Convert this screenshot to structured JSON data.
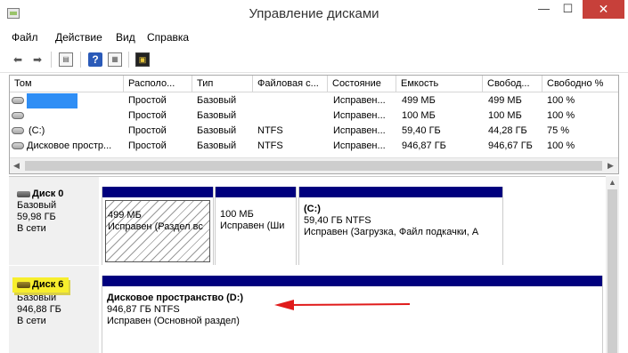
{
  "window": {
    "title": "Управление дисками",
    "minimize_glyph": "—",
    "maximize_glyph": "☐",
    "close_glyph": "✕",
    "app_icon": "disk-management-icon"
  },
  "menu": [
    "Файл",
    "Действие",
    "Вид",
    "Справка"
  ],
  "toolbar": {
    "icons": [
      "back-arrow-icon",
      "forward-arrow-icon",
      "console-tree-icon",
      "help-icon",
      "properties-icon",
      "snap-in-icon"
    ],
    "back_glyph": "⬅",
    "forward_glyph": "➡",
    "help_glyph": "?"
  },
  "volumes": {
    "columns": [
      "Том",
      "Располо...",
      "Тип",
      "Файловая с...",
      "Состояние",
      "Емкость",
      "Свобод...",
      "Свободно %"
    ],
    "rows": [
      {
        "name": "",
        "layout": "Простой",
        "type": "Базовый",
        "fs": "",
        "status": "Исправен...",
        "capacity": "499 МБ",
        "free": "499 МБ",
        "free_pct": "100 %"
      },
      {
        "name": "",
        "layout": "Простой",
        "type": "Базовый",
        "fs": "",
        "status": "Исправен...",
        "capacity": "100 МБ",
        "free": "100 МБ",
        "free_pct": "100 %"
      },
      {
        "name": "(C:)",
        "layout": "Простой",
        "type": "Базовый",
        "fs": "NTFS",
        "status": "Исправен...",
        "capacity": "59,40 ГБ",
        "free": "44,28 ГБ",
        "free_pct": "75 %"
      },
      {
        "name": "Дисковое простр...",
        "layout": "Простой",
        "type": "Базовый",
        "fs": "NTFS",
        "status": "Исправен...",
        "capacity": "946,87 ГБ",
        "free": "946,67 ГБ",
        "free_pct": "100 %"
      }
    ]
  },
  "disks": [
    {
      "name": "Диск 0",
      "type": "Базовый",
      "size": "59,98 ГБ",
      "state": "В сети",
      "partitions": [
        {
          "title": "",
          "size": "499 МБ",
          "status": "Исправен (Раздел вс"
        },
        {
          "title": "",
          "size": "100 МБ",
          "status": "Исправен (Ши"
        },
        {
          "title": "(C:)",
          "size": "59,40 ГБ NTFS",
          "status": "Исправен (Загрузка, Файл подкачки, А"
        }
      ]
    },
    {
      "name": "Диск 6",
      "type": "Базовый",
      "size": "946,88 ГБ",
      "state": "В сети",
      "partitions": [
        {
          "title": "Дисковое пространство  (D:)",
          "size": "946,87 ГБ NTFS",
          "status": "Исправен (Основной раздел)"
        }
      ]
    }
  ],
  "colors": {
    "partition_header": "#00007e",
    "highlight": "#f7ee2d",
    "arrow": "#e01b1b",
    "redaction": "#2f8ef5"
  }
}
